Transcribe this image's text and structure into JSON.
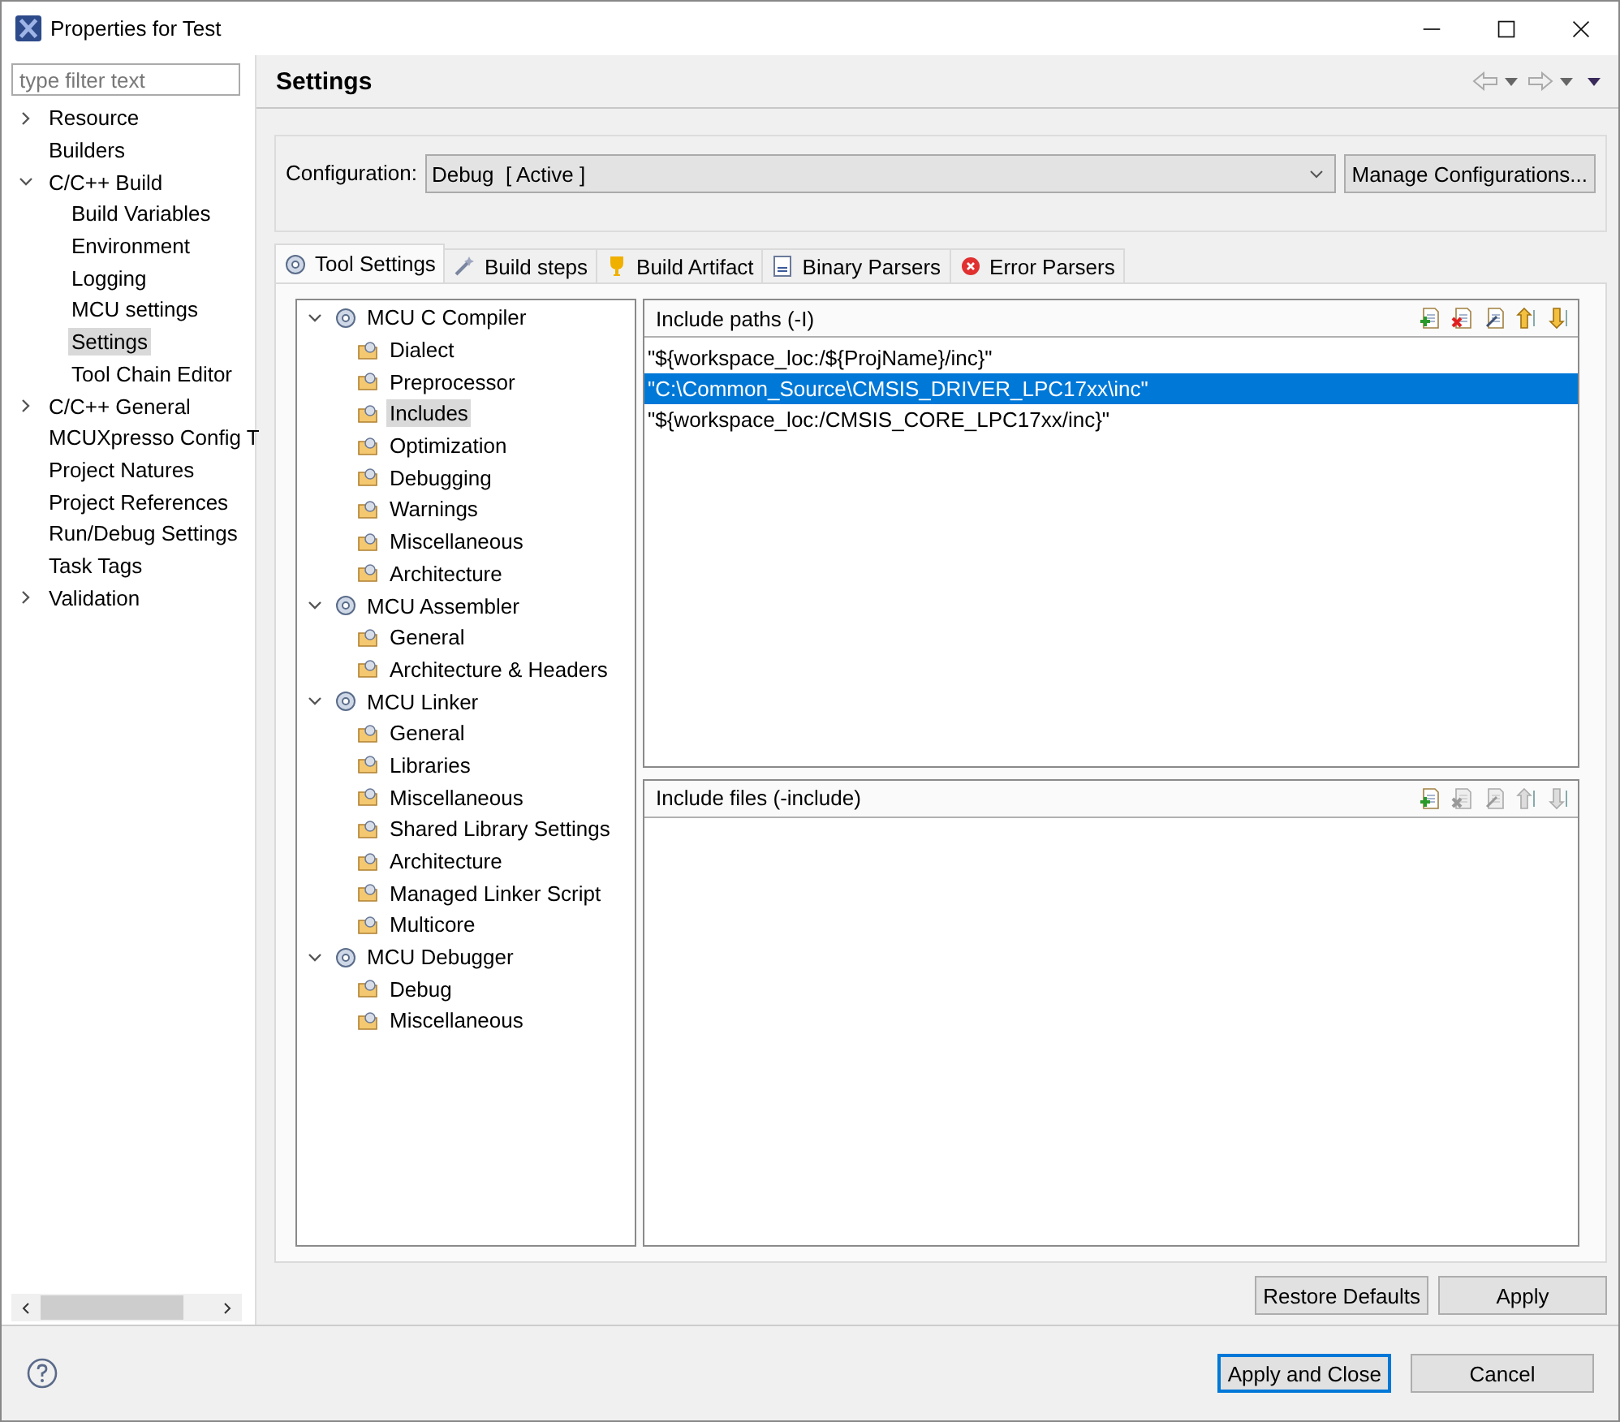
{
  "window": {
    "title": "Properties for Test"
  },
  "filter": {
    "placeholder": "type filter text"
  },
  "nav": [
    {
      "label": "Resource",
      "expanded": false,
      "selected": false
    },
    {
      "label": "Builders",
      "selected": false
    },
    {
      "label": "C/C++ Build",
      "expanded": true,
      "selected": false,
      "children": [
        {
          "label": "Build Variables",
          "selected": false
        },
        {
          "label": "Environment",
          "selected": false
        },
        {
          "label": "Logging",
          "selected": false
        },
        {
          "label": "MCU settings",
          "selected": false
        },
        {
          "label": "Settings",
          "selected": true
        },
        {
          "label": "Tool Chain Editor",
          "selected": false
        }
      ]
    },
    {
      "label": "C/C++ General",
      "expanded": false,
      "selected": false
    },
    {
      "label": "MCUXpresso Config T",
      "selected": false
    },
    {
      "label": "Project Natures",
      "selected": false
    },
    {
      "label": "Project References",
      "selected": false
    },
    {
      "label": "Run/Debug Settings",
      "selected": false
    },
    {
      "label": "Task Tags",
      "selected": false
    },
    {
      "label": "Validation",
      "expanded": false,
      "selected": false
    }
  ],
  "page_title": "Settings",
  "configuration": {
    "label": "Configuration:",
    "value": "Debug  [ Active ]",
    "button": "Manage Configurations..."
  },
  "tabs": [
    {
      "label": "Tool Settings",
      "kind": "gear",
      "selected": true
    },
    {
      "label": "Build steps",
      "kind": "wand",
      "selected": false
    },
    {
      "label": "Build Artifact",
      "kind": "trophy",
      "selected": false
    },
    {
      "label": "Binary Parsers",
      "kind": "binary",
      "selected": false
    },
    {
      "label": "Error Parsers",
      "kind": "error",
      "selected": false
    }
  ],
  "tool_tree": [
    {
      "label": "MCU C Compiler",
      "expanded": true,
      "children": [
        {
          "label": "Dialect",
          "selected": false
        },
        {
          "label": "Preprocessor",
          "selected": false
        },
        {
          "label": "Includes",
          "selected": true
        },
        {
          "label": "Optimization",
          "selected": false
        },
        {
          "label": "Debugging",
          "selected": false
        },
        {
          "label": "Warnings",
          "selected": false
        },
        {
          "label": "Miscellaneous",
          "selected": false
        },
        {
          "label": "Architecture",
          "selected": false
        }
      ]
    },
    {
      "label": "MCU Assembler",
      "expanded": true,
      "children": [
        {
          "label": "General",
          "selected": false
        },
        {
          "label": "Architecture & Headers",
          "selected": false
        }
      ]
    },
    {
      "label": "MCU Linker",
      "expanded": true,
      "children": [
        {
          "label": "General",
          "selected": false
        },
        {
          "label": "Libraries",
          "selected": false
        },
        {
          "label": "Miscellaneous",
          "selected": false
        },
        {
          "label": "Shared Library Settings",
          "selected": false
        },
        {
          "label": "Architecture",
          "selected": false
        },
        {
          "label": "Managed Linker Script",
          "selected": false
        },
        {
          "label": "Multicore",
          "selected": false
        }
      ]
    },
    {
      "label": "MCU Debugger",
      "expanded": true,
      "children": [
        {
          "label": "Debug",
          "selected": false
        },
        {
          "label": "Miscellaneous",
          "selected": false
        }
      ]
    }
  ],
  "panes": [
    {
      "title": "Include paths (-I)",
      "tools": [
        {
          "kind": "add",
          "disabled": false
        },
        {
          "kind": "delete",
          "disabled": false
        },
        {
          "kind": "edit",
          "disabled": false
        },
        {
          "kind": "up",
          "disabled": false
        },
        {
          "kind": "down",
          "disabled": false
        }
      ],
      "rows": [
        {
          "text": "\"${workspace_loc:/${ProjName}/inc}\"",
          "selected": false
        },
        {
          "text": "\"C:\\Common_Source\\CMSIS_DRIVER_LPC17xx\\inc\"",
          "selected": true
        },
        {
          "text": "\"${workspace_loc:/CMSIS_CORE_LPC17xx/inc}\"",
          "selected": false
        }
      ]
    },
    {
      "title": "Include files (-include)",
      "tools": [
        {
          "kind": "add",
          "disabled": false
        },
        {
          "kind": "delete",
          "disabled": true
        },
        {
          "kind": "edit",
          "disabled": true
        },
        {
          "kind": "up",
          "disabled": true
        },
        {
          "kind": "down",
          "disabled": true
        }
      ]
    }
  ],
  "page_buttons": [
    "Restore Defaults",
    "Apply"
  ],
  "dialog_buttons": [
    {
      "label": "Apply and Close",
      "default": true
    },
    {
      "label": "Cancel",
      "default": false
    }
  ]
}
